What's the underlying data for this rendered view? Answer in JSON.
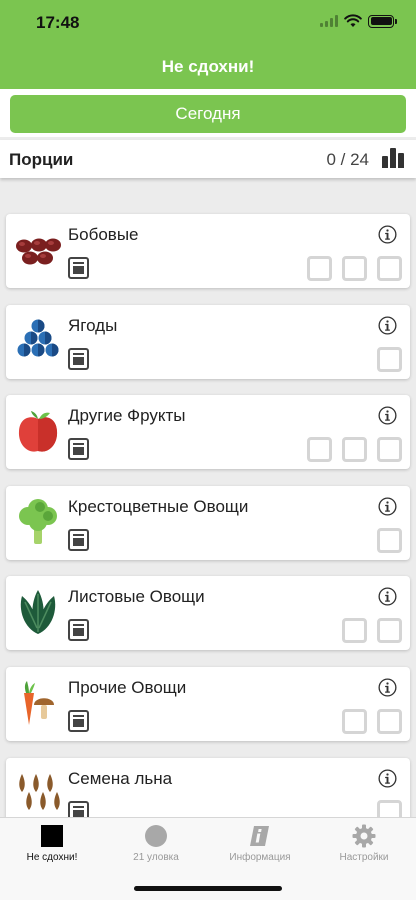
{
  "status_bar": {
    "time": "17:48"
  },
  "header": {
    "title": "Не сдохни!"
  },
  "today_button": {
    "label": "Сегодня"
  },
  "portions": {
    "label": "Порции",
    "count": "0 / 24"
  },
  "categories": [
    {
      "title": "Бобовые",
      "servings": 3,
      "icon": "beans-icon"
    },
    {
      "title": "Ягоды",
      "servings": 1,
      "icon": "berries-icon"
    },
    {
      "title": "Другие Фрукты",
      "servings": 3,
      "icon": "apple-icon"
    },
    {
      "title": "Крестоцветные Овощи",
      "servings": 1,
      "icon": "broccoli-icon"
    },
    {
      "title": "Листовые Овощи",
      "servings": 2,
      "icon": "leafy-greens-icon"
    },
    {
      "title": "Прочие Овощи",
      "servings": 2,
      "icon": "carrot-mushroom-icon"
    },
    {
      "title": "Семена льна",
      "servings": 1,
      "icon": "flaxseed-icon"
    }
  ],
  "tabbar": {
    "tabs": [
      {
        "label": "Не сдохни!",
        "icon": "square-icon",
        "active": true
      },
      {
        "label": "21 уловка",
        "icon": "circle-icon",
        "active": false
      },
      {
        "label": "Информация",
        "icon": "info-book-icon",
        "active": false
      },
      {
        "label": "Настройки",
        "icon": "gear-icon",
        "active": false
      }
    ]
  },
  "colors": {
    "accent": "#7bc550",
    "checkbox_border": "#d5d5d5"
  }
}
